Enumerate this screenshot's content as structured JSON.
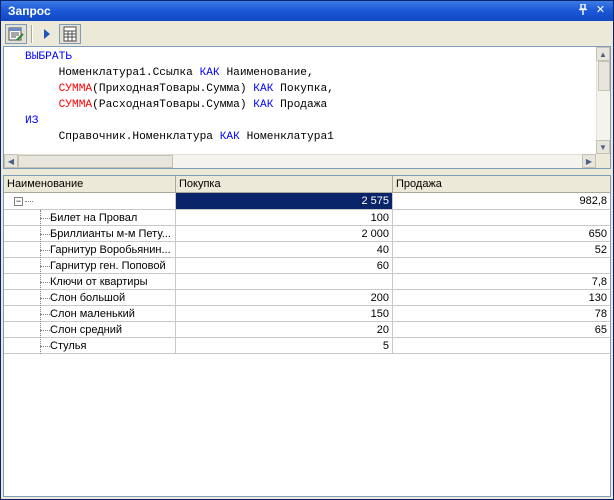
{
  "window": {
    "title": "Запрос"
  },
  "icons": {
    "pin": "pin-icon",
    "close": "close-icon",
    "tool1": "query-wizard-icon",
    "tool2": "run-query-icon",
    "tool3": "table-icon"
  },
  "query": {
    "kw_select": "ВЫБРАТЬ",
    "line1_text": "Номенклатура1.Ссылка ",
    "kw_as": "КАК",
    "alias1": " Наименование,",
    "fn_sum": "СУММА",
    "line2_arg": "(ПриходнаяТовары.Сумма) ",
    "alias2": " Покупка,",
    "line3_arg": "(РасходнаяТовары.Сумма) ",
    "alias3": " Продажа",
    "kw_from": "ИЗ",
    "line5_text": "Справочник.Номенклатура ",
    "alias5": " Номенклатура1"
  },
  "grid": {
    "columns": [
      "Наименование",
      "Покупка",
      "Продажа"
    ],
    "root": {
      "label": "",
      "purchase": "2 575",
      "sale": "982,8"
    },
    "rows": [
      {
        "name": "Билет на Провал",
        "purchase": "100",
        "sale": ""
      },
      {
        "name": "Бриллианты м-м Пету...",
        "purchase": "2 000",
        "sale": "650"
      },
      {
        "name": "Гарнитур Воробьянин...",
        "purchase": "40",
        "sale": "52"
      },
      {
        "name": "Гарнитур ген. Поповой",
        "purchase": "60",
        "sale": ""
      },
      {
        "name": "Ключи от квартиры",
        "purchase": "",
        "sale": "7,8"
      },
      {
        "name": "Слон большой",
        "purchase": "200",
        "sale": "130"
      },
      {
        "name": "Слон маленький",
        "purchase": "150",
        "sale": "78"
      },
      {
        "name": "Слон средний",
        "purchase": "20",
        "sale": "65"
      },
      {
        "name": "Стулья",
        "purchase": "5",
        "sale": ""
      }
    ]
  }
}
